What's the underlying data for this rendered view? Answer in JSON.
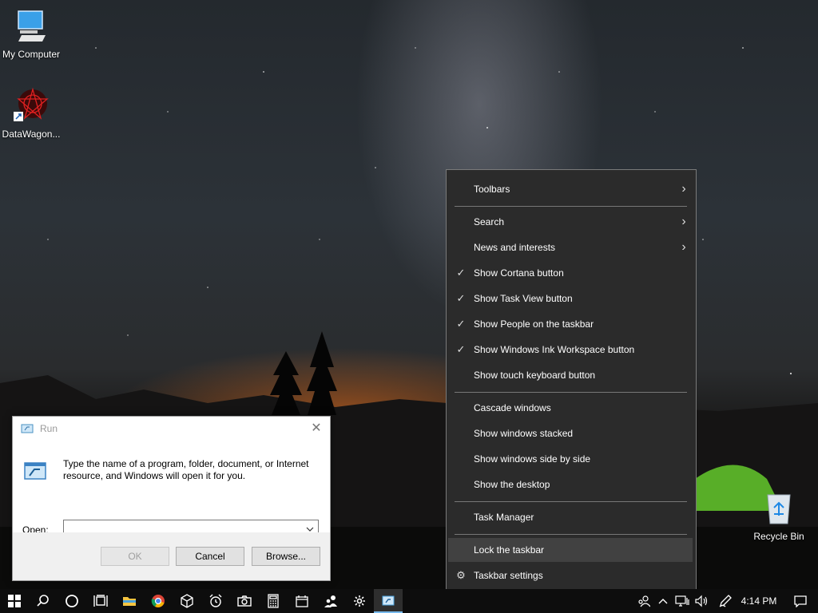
{
  "desktop": {
    "icons": [
      {
        "label": "My Computer",
        "icon": "computer-icon"
      },
      {
        "label": "DataWagon...",
        "icon": "datawagon-icon"
      },
      {
        "label": "Recycle Bin",
        "icon": "recycle-bin-icon"
      }
    ]
  },
  "run_dialog": {
    "title": "Run",
    "close": "✕",
    "description": "Type the name of a program, folder, document, or Internet resource, and Windows will open it for you.",
    "open_label": "Open:",
    "open_value": "",
    "ok_label": "OK",
    "cancel_label": "Cancel",
    "browse_label": "Browse..."
  },
  "context_menu": {
    "items": [
      {
        "label": "Toolbars",
        "submenu": true
      },
      {
        "label": "Search",
        "submenu": true
      },
      {
        "label": "News and interests",
        "submenu": true
      },
      {
        "label": "Show Cortana button",
        "checked": true
      },
      {
        "label": "Show Task View button",
        "checked": true
      },
      {
        "label": "Show People on the taskbar",
        "checked": true
      },
      {
        "label": "Show Windows Ink Workspace button",
        "checked": true
      },
      {
        "label": "Show touch keyboard button"
      },
      {
        "label": "Cascade windows"
      },
      {
        "label": "Show windows stacked"
      },
      {
        "label": "Show windows side by side"
      },
      {
        "label": "Show the desktop"
      },
      {
        "label": "Task Manager"
      },
      {
        "label": "Lock the taskbar",
        "highlighted": true
      },
      {
        "label": "Taskbar settings",
        "icon": "gear-icon"
      }
    ],
    "check_glyph": "✓",
    "arrow_glyph": "›",
    "gear_glyph": "⚙"
  },
  "taskbar": {
    "clock": "4:14 PM",
    "accent": "#76b9ed",
    "apps": [
      "start-icon",
      "search-icon",
      "cortana-icon",
      "task-view-icon",
      "file-explorer-icon",
      "chrome-icon",
      "cube-icon",
      "alarm-icon",
      "camera-icon",
      "calculator-icon",
      "calendar-icon",
      "people-app-icon",
      "settings-icon",
      "run-icon"
    ]
  }
}
